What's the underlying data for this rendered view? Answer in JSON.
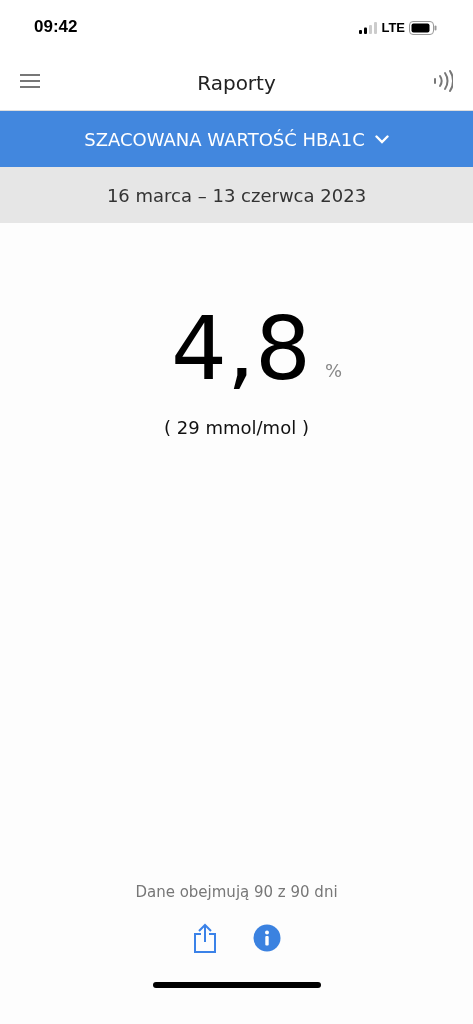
{
  "status_bar": {
    "time": "09:42",
    "network": "LTE"
  },
  "header": {
    "title": "Raporty"
  },
  "report_selector": {
    "label": "SZACOWANA WARTOŚĆ HBA1C"
  },
  "date_range": "16 marca – 13 czerwca 2023",
  "result": {
    "value": "4,8",
    "unit": "%",
    "secondary": "( 29 mmol/mol )"
  },
  "footer": {
    "coverage": "Dane obejmują 90 z 90 dni"
  }
}
